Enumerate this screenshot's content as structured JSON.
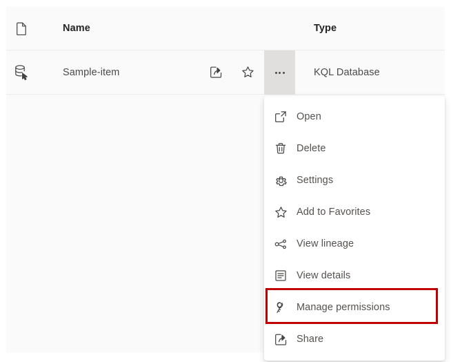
{
  "table": {
    "columns": [
      {
        "id": "icon",
        "label": "",
        "icon": "document-icon"
      },
      {
        "id": "name",
        "label": "Name"
      },
      {
        "id": "type",
        "label": "Type"
      }
    ],
    "rows": [
      {
        "icon": "kql-database-icon",
        "name": "Sample-item",
        "type": "KQL Database",
        "actions": [
          {
            "name": "share-icon",
            "label": "Share"
          },
          {
            "name": "favorite-star-icon",
            "label": "Add to Favorites"
          },
          {
            "name": "more-options-icon",
            "label": "More options"
          }
        ]
      }
    ]
  },
  "context_menu": {
    "items": [
      {
        "label": "Open",
        "icon": "open-external-icon"
      },
      {
        "label": "Delete",
        "icon": "trash-icon"
      },
      {
        "label": "Settings",
        "icon": "gear-icon"
      },
      {
        "label": "Add to Favorites",
        "icon": "star-icon"
      },
      {
        "label": "View lineage",
        "icon": "lineage-icon"
      },
      {
        "label": "View details",
        "icon": "details-list-icon"
      },
      {
        "label": "Manage permissions",
        "icon": "key-icon",
        "highlighted": true
      },
      {
        "label": "Share",
        "icon": "share-icon"
      }
    ]
  },
  "annotation": {
    "highlight_target": "Manage permissions",
    "highlight_color": "#c00000"
  },
  "colors": {
    "surface": "#ffffff",
    "table_background": "#fafafa",
    "row_divider": "#ededed",
    "more_button_background": "#e1dfdd",
    "header_text": "#242424",
    "body_text": "#4a4a4a",
    "menu_text": "#55514e",
    "annotation_red": "#c00000"
  }
}
